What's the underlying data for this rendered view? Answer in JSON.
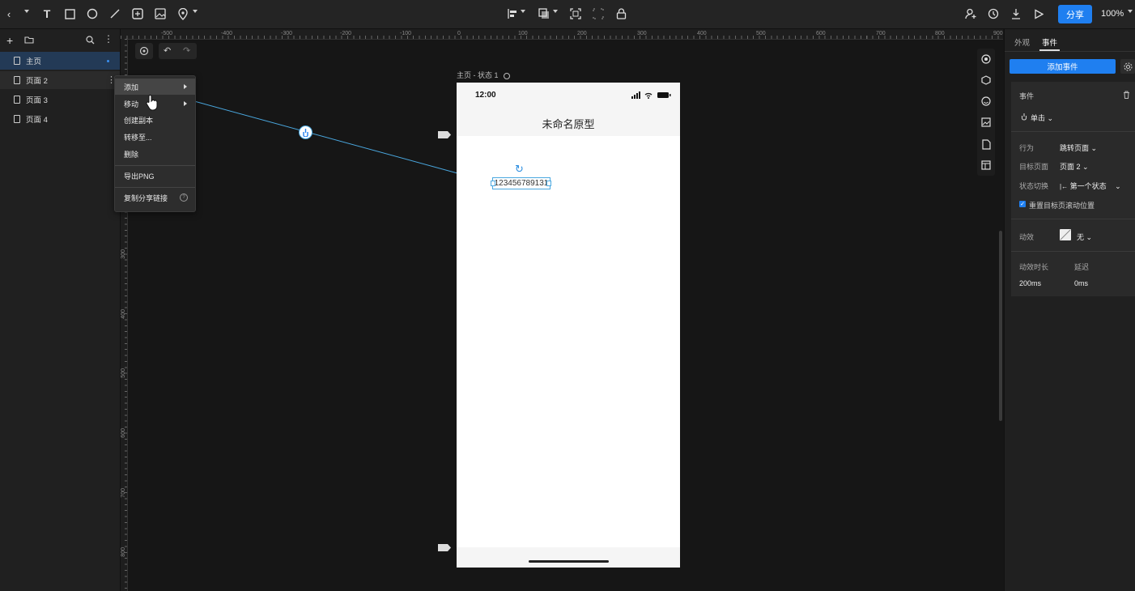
{
  "toolbar": {
    "share_label": "分享",
    "zoom_label": "100%",
    "icons": [
      "back-icon",
      "text-tool-icon",
      "rectangle-tool-icon",
      "ellipse-tool-icon",
      "line-tool-icon",
      "frame-tool-icon",
      "image-tool-icon",
      "pin-tool-icon",
      "align-icon",
      "arrange-icon",
      "fit-icon",
      "group-icon",
      "lock-icon",
      "collaborate-icon",
      "history-icon",
      "download-icon",
      "play-icon"
    ]
  },
  "pages": {
    "items": [
      {
        "label": "主页"
      },
      {
        "label": "页面 2"
      },
      {
        "label": "页面 3"
      },
      {
        "label": "页面 4"
      }
    ]
  },
  "context_menu": {
    "items": [
      {
        "label": "添加"
      },
      {
        "label": "移动"
      },
      {
        "label": "创建副本"
      },
      {
        "label": "转移至..."
      },
      {
        "label": "删除"
      },
      {
        "label": "导出PNG"
      },
      {
        "label": "复制分享链接"
      }
    ]
  },
  "ruler": {
    "h_ticks": [
      "-500",
      "-400",
      "-300",
      "-200",
      "-100",
      "0",
      "100",
      "200",
      "300",
      "400",
      "500",
      "600",
      "700",
      "800",
      "900"
    ],
    "v_ticks": [
      "300",
      "400",
      "500",
      "600",
      "700",
      "800"
    ]
  },
  "canvas": {
    "frame_label": "主页 - 状态 1",
    "phone_time": "12:00",
    "phone_title": "未命名原型",
    "text_element": "123456789131"
  },
  "right_panel": {
    "tabs": [
      {
        "label": "外观"
      },
      {
        "label": "事件"
      }
    ],
    "add_event_label": "添加事件",
    "event_label": "事件",
    "trigger_value": "单击",
    "action_label": "行为",
    "action_value": "跳转页面",
    "target_label": "目标页面",
    "target_value": "页面 2",
    "state_label": "状态切换",
    "state_value": "第一个状态",
    "reset_scroll_label": "重置目标页滚动位置",
    "animation_label": "动效",
    "animation_value": "无",
    "duration_label": "动效时长",
    "delay_label": "延迟",
    "duration_value": "200ms",
    "delay_value": "0ms"
  },
  "colors": {
    "accent": "#1f7ff0",
    "selected_row": "#233a56",
    "link_line": "#4aa8e0"
  }
}
